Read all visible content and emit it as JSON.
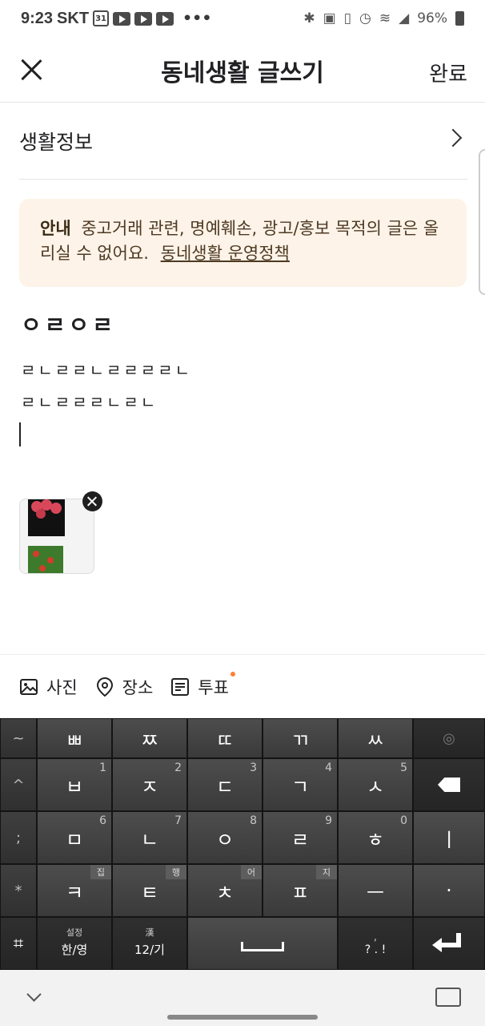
{
  "status": {
    "time": "9:23",
    "carrier": "SKT",
    "calendar": "31",
    "more": "•••",
    "battery": "96%",
    "icons": [
      "bluetooth-icon",
      "nfc-icon",
      "vibrate-icon",
      "alarm-icon",
      "wifi-icon",
      "signal-icon",
      "battery-icon"
    ]
  },
  "header": {
    "title": "동네생활 글쓰기",
    "done": "완료"
  },
  "category": {
    "label": "생활정보"
  },
  "notice": {
    "bold": "안내",
    "text": "중고거래 관련, 명예훼손, 광고/홍보 목적의 글은 올리실 수 없어요.",
    "link": "동네생활 운영정책"
  },
  "post": {
    "title": "ㅇㄹㅇㄹ",
    "lines": [
      "ㄹㄴㄹㄹㄴㄹㄹㄹㄹㄴ",
      "ㄹㄴㄹㄹㄹㄴㄹㄴ"
    ]
  },
  "toolbar": {
    "photo": "사진",
    "place": "장소",
    "vote": "투표"
  },
  "keyboard": {
    "row1": [
      "~",
      "ㅃ",
      "ㅉ",
      "ㄸ",
      "ㄲ",
      "ㅆ",
      ""
    ],
    "row2": [
      {
        "main": "^",
        "num": ""
      },
      {
        "main": "ㅂ",
        "num": "1"
      },
      {
        "main": "ㅈ",
        "num": "2"
      },
      {
        "main": "ㄷ",
        "num": "3"
      },
      {
        "main": "ㄱ",
        "num": "4"
      },
      {
        "main": "ㅅ",
        "num": "5"
      }
    ],
    "row3": [
      {
        "main": ";",
        "num": ""
      },
      {
        "main": "ㅁ",
        "num": "6"
      },
      {
        "main": "ㄴ",
        "num": "7"
      },
      {
        "main": "ㅇ",
        "num": "8"
      },
      {
        "main": "ㄹ",
        "num": "9"
      },
      {
        "main": "ㅎ",
        "num": "0"
      },
      {
        "main": "ㅣ",
        "num": ""
      }
    ],
    "row4": [
      {
        "main": "*",
        "tag": ""
      },
      {
        "main": "ㅋ",
        "tag": "집"
      },
      {
        "main": "ㅌ",
        "tag": "행"
      },
      {
        "main": "ㅊ",
        "tag": "어"
      },
      {
        "main": "ㅍ",
        "tag": "지"
      },
      {
        "main": "ㅡ",
        "tag": ""
      },
      {
        "main": "·",
        "tag": ""
      }
    ],
    "lang_top": "설정",
    "lang": "한/영",
    "symbol_top": "漢",
    "symbol": "12/기",
    "punct": "? . !",
    "punct_top": ","
  }
}
